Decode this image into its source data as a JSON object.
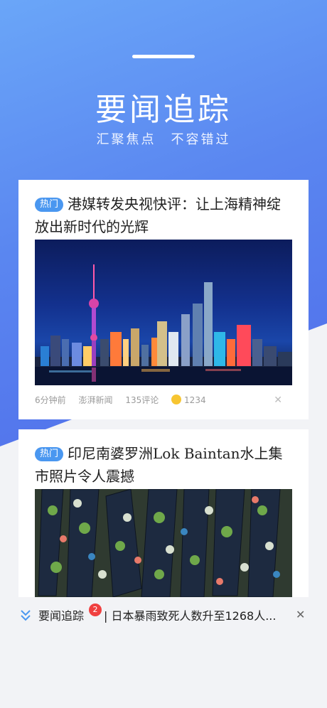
{
  "header": {
    "title": "要闻追踪",
    "subtitle": "汇聚焦点　不容错过"
  },
  "cards": [
    {
      "badge": "热门",
      "title": "港媒转发央视快评：让上海精神绽放出新时代的光辉",
      "image": "shanghai-skyline-night",
      "meta": {
        "time": "6分钟前",
        "source": "澎湃新闻",
        "comments": "135评论",
        "reactions": "1234"
      }
    },
    {
      "badge": "热门",
      "title": "印尼南婆罗洲Lok Baintan水上集市照片令人震撼",
      "image": "floating-market-boats"
    }
  ],
  "bottom_bar": {
    "label": "要闻追踪",
    "badge_count": "2",
    "separator": "|",
    "news_text": "日本暴雨致死人数升至1268人..."
  },
  "colors": {
    "gradient_start": "#6aa6f8",
    "gradient_end": "#4f6cea",
    "badge": "#4a97f0",
    "notification": "#f04040"
  }
}
